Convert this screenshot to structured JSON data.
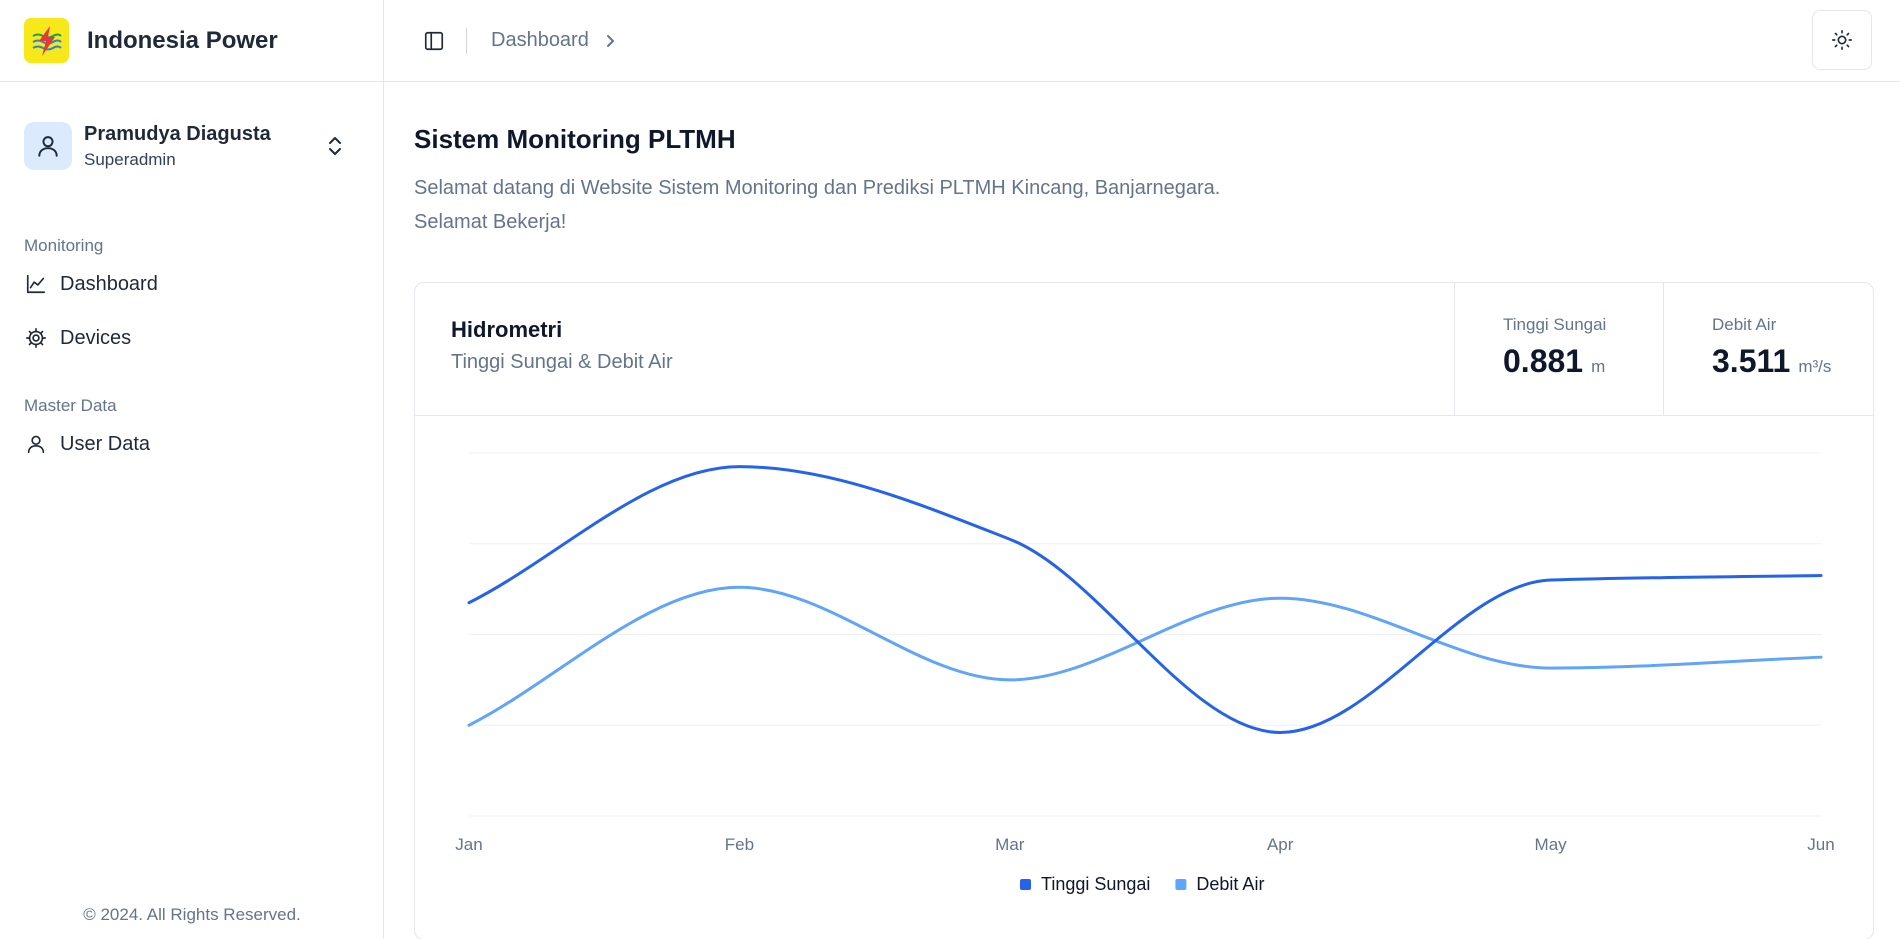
{
  "app": {
    "brand_name": "Indonesia Power",
    "logo_icon": "power-logo-icon"
  },
  "user": {
    "name": "Pramudya Diagusta",
    "role": "Superadmin"
  },
  "sidebar": {
    "groups": [
      {
        "label": "Monitoring",
        "items": [
          {
            "label": "Dashboard",
            "icon": "line-chart-icon"
          },
          {
            "label": "Devices",
            "icon": "gear-icon"
          }
        ]
      },
      {
        "label": "Master Data",
        "items": [
          {
            "label": "User Data",
            "icon": "user-icon"
          }
        ]
      }
    ],
    "footer": "© 2024. All Rights Reserved."
  },
  "topbar": {
    "breadcrumb": "Dashboard"
  },
  "page": {
    "title": "Sistem Monitoring PLTMH",
    "description_line1": "Selamat datang di Website Sistem Monitoring dan Prediksi PLTMH Kincang, Banjarnegara.",
    "description_line2": "Selamat Bekerja!"
  },
  "card": {
    "title": "Hidrometri",
    "subtitle": "Tinggi Sungai & Debit Air",
    "stats": [
      {
        "label": "Tinggi Sungai",
        "value": "0.881",
        "unit": "m"
      },
      {
        "label": "Debit Air",
        "value": "3.511",
        "unit": "m³/s"
      }
    ]
  },
  "colors": {
    "series_primary": "#2563eb",
    "series_secondary": "#60a5fa",
    "grid": "#eef0f3"
  },
  "chart_data": {
    "type": "line",
    "categories": [
      "Jan",
      "Feb",
      "Mar",
      "Apr",
      "May",
      "Jun"
    ],
    "series": [
      {
        "name": "Tinggi Sungai",
        "values": [
          235,
          385,
          305,
          92,
          260,
          265
        ]
      },
      {
        "name": "Debit Air",
        "values": [
          100,
          252,
          150,
          240,
          163,
          175
        ]
      }
    ],
    "ylim": [
      0,
      400
    ],
    "grid": true,
    "legend": "bottom-center"
  }
}
